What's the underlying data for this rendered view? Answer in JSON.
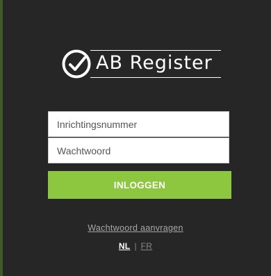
{
  "brand": {
    "name": "AB Register",
    "icon": "check-circle-icon",
    "colors": {
      "panel": "#262626",
      "accent": "#8dc63f",
      "text": "#ffffff",
      "link": "#a8a8a8"
    }
  },
  "form": {
    "username_placeholder": "Inrichtingsnummer",
    "password_placeholder": "Wachtwoord",
    "login_label": "INLOGGEN"
  },
  "links": {
    "forgot_password": "Wachtwoord aanvragen"
  },
  "language": {
    "active": "NL",
    "separator": "|",
    "other": "FR"
  }
}
